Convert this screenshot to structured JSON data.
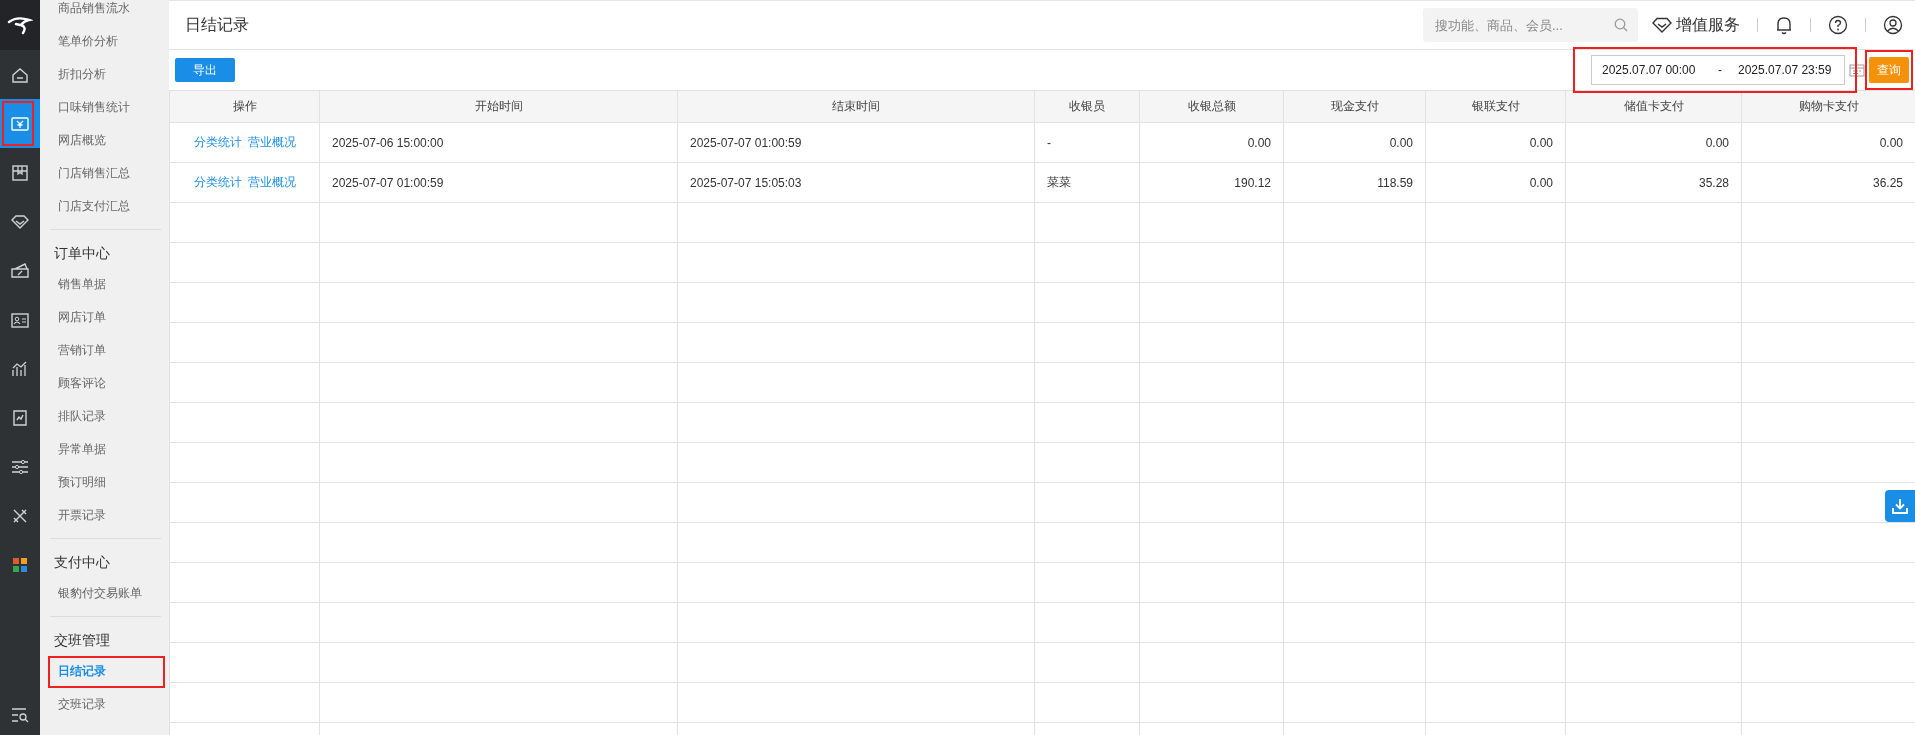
{
  "rail": {
    "icons": [
      {
        "kind": "home",
        "selected": false,
        "highlighted": false
      },
      {
        "kind": "money",
        "selected": true,
        "highlighted": true
      },
      {
        "kind": "box",
        "selected": false,
        "highlighted": false
      },
      {
        "kind": "diamond",
        "selected": false,
        "highlighted": false
      },
      {
        "kind": "ticket",
        "selected": false,
        "highlighted": false
      },
      {
        "kind": "idcard",
        "selected": false,
        "highlighted": false
      },
      {
        "kind": "chart",
        "selected": false,
        "highlighted": false
      },
      {
        "kind": "report",
        "selected": false,
        "highlighted": false
      },
      {
        "kind": "sliders",
        "selected": false,
        "highlighted": false
      },
      {
        "kind": "tools",
        "selected": false,
        "highlighted": false
      },
      {
        "kind": "apps",
        "selected": false,
        "highlighted": false
      }
    ]
  },
  "sidebar": {
    "groups": [
      {
        "items": [
          {
            "label": "商品销售流水",
            "selected": false,
            "highlighted": false
          },
          {
            "label": "笔单价分析",
            "selected": false,
            "highlighted": false
          },
          {
            "label": "折扣分析",
            "selected": false,
            "highlighted": false
          },
          {
            "label": "口味销售统计",
            "selected": false,
            "highlighted": false
          },
          {
            "label": "网店概览",
            "selected": false,
            "highlighted": false
          },
          {
            "label": "门店销售汇总",
            "selected": false,
            "highlighted": false
          },
          {
            "label": "门店支付汇总",
            "selected": false,
            "highlighted": false
          }
        ]
      },
      {
        "title": "订单中心",
        "items": [
          {
            "label": "销售单据",
            "selected": false,
            "highlighted": false
          },
          {
            "label": "网店订单",
            "selected": false,
            "highlighted": false
          },
          {
            "label": "营销订单",
            "selected": false,
            "highlighted": false
          },
          {
            "label": "顾客评论",
            "selected": false,
            "highlighted": false
          },
          {
            "label": "排队记录",
            "selected": false,
            "highlighted": false
          },
          {
            "label": "异常单据",
            "selected": false,
            "highlighted": false
          },
          {
            "label": "预订明细",
            "selected": false,
            "highlighted": false
          },
          {
            "label": "开票记录",
            "selected": false,
            "highlighted": false
          }
        ]
      },
      {
        "title": "支付中心",
        "items": [
          {
            "label": "银豹付交易账单",
            "selected": false,
            "highlighted": false
          }
        ]
      },
      {
        "title": "交班管理",
        "items": [
          {
            "label": "日结记录",
            "selected": true,
            "highlighted": true
          },
          {
            "label": "交班记录",
            "selected": false,
            "highlighted": false
          }
        ]
      }
    ]
  },
  "header": {
    "title": "日结记录",
    "search": {
      "placeholder": "搜功能、商品、会员..."
    },
    "value_service": "增值服务"
  },
  "toolbar": {
    "export_button": "导出",
    "date_range": {
      "start": "2025.07.07 00:00",
      "separator": "-",
      "end": "2025.07.07 23:59",
      "highlighted": true
    },
    "query_button": {
      "label": "查询",
      "highlighted": true
    }
  },
  "table": {
    "columns": [
      "操作",
      "开始时间",
      "结束时间",
      "收银员",
      "收银总额",
      "现金支付",
      "银联支付",
      "储值卡支付",
      "购物卡支付"
    ],
    "rows": [
      {
        "cells": [
          [
            "分类统计",
            "营业概况"
          ],
          "2025-07-06 15:00:00",
          "2025-07-07 01:00:59",
          "-",
          "0.00",
          "0.00",
          "0.00",
          "0.00",
          "0.00"
        ]
      },
      {
        "cells": [
          [
            "分类统计",
            "营业概况"
          ],
          "2025-07-07 01:00:59",
          "2025-07-07 15:05:03",
          "菜菜",
          "190.12",
          "118.59",
          "0.00",
          "35.28",
          "36.25"
        ]
      }
    ]
  }
}
